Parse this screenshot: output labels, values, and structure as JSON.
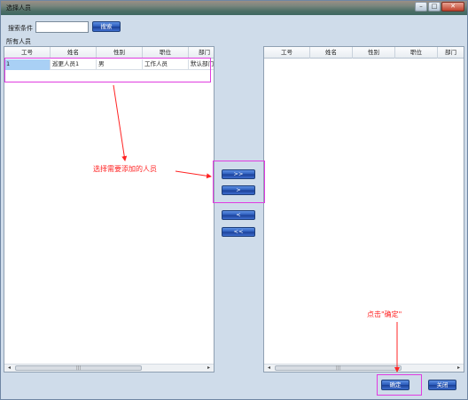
{
  "window": {
    "title": "选择人员",
    "buttons": [
      "–",
      "□",
      "✕"
    ]
  },
  "search": {
    "label": "搜索条件",
    "value": "",
    "placeholder": "",
    "button_label": "搜索"
  },
  "group_label": "所有人员",
  "left_table": {
    "columns": [
      "工号",
      "姓名",
      "性别",
      "职位",
      "部门"
    ],
    "rows": [
      [
        "1",
        "巡更人员1",
        "男",
        "工作人员",
        "默认部门"
      ]
    ]
  },
  "right_table": {
    "columns": [
      "工号",
      "姓名",
      "性别",
      "职位",
      "部门"
    ]
  },
  "move_buttons": [
    ">>",
    ">",
    "<",
    "<<"
  ],
  "scrollbar": {
    "left_arrow": "◂",
    "right_arrow": "▸",
    "grip": "|||"
  },
  "annotations": {
    "select_people": "选择需要添加的人员",
    "click_confirm": "点击\"确定\""
  },
  "footer": {
    "ok_label": "确定",
    "close_label": "关闭"
  },
  "colors": {
    "annotation_box": "#e03ce0",
    "annotation_text": "#ff2424",
    "selection": "#a9d0f5",
    "button": "#2c5cbc"
  }
}
